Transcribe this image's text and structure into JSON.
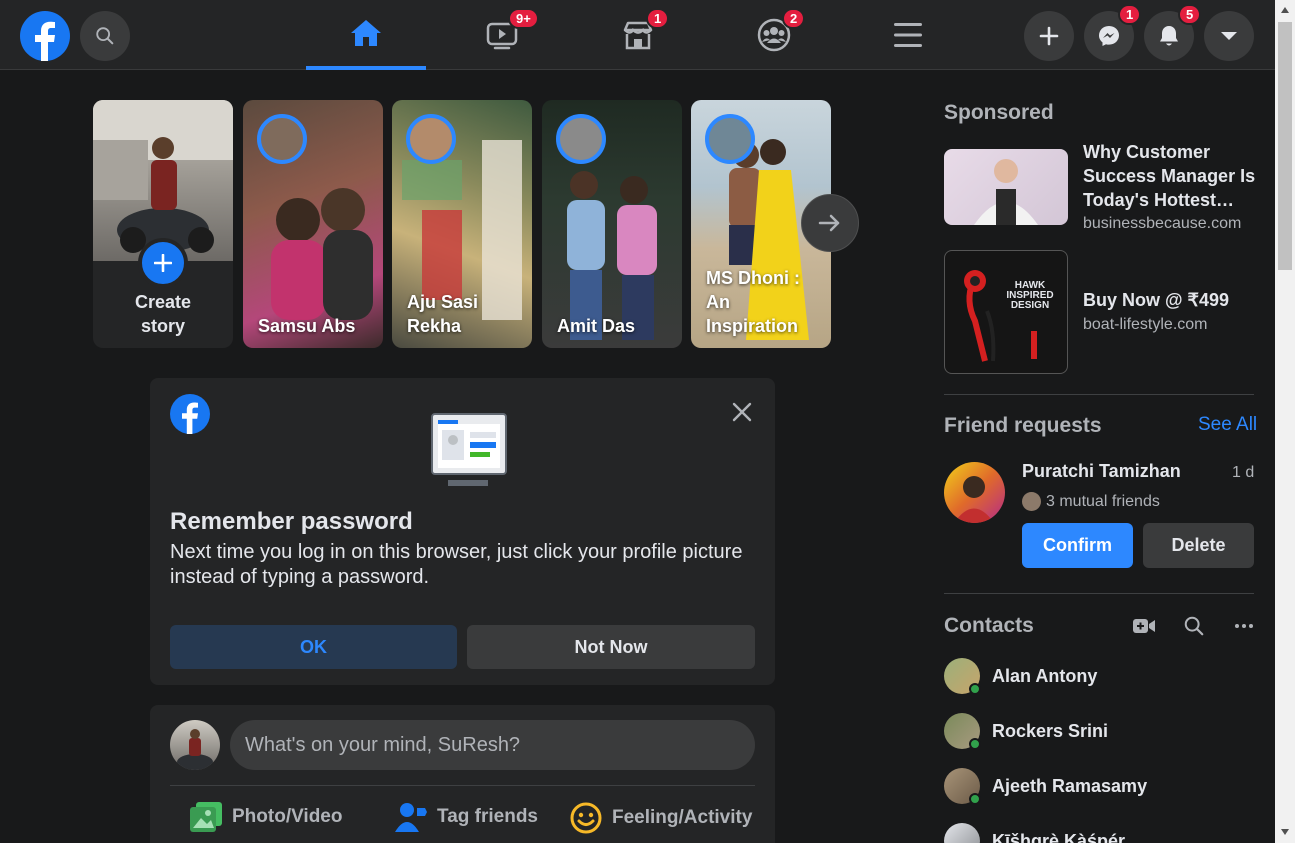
{
  "topbar": {
    "badges": {
      "watch": "9+",
      "marketplace": "1",
      "groups": "2",
      "messenger": "1",
      "notifications": "5"
    }
  },
  "stories": {
    "create_label": "Create story",
    "items": [
      {
        "name": "Samsu Abs"
      },
      {
        "name": "Aju Sasi Rekha"
      },
      {
        "name": "Amit Das"
      },
      {
        "name": "MS Dhoni : An Inspiration"
      }
    ]
  },
  "remember": {
    "title": "Remember password",
    "body": "Next time you log in on this browser, just click your profile picture instead of typing a password.",
    "ok_label": "OK",
    "not_now_label": "Not Now"
  },
  "composer": {
    "placeholder": "What's on your mind, SuResh?",
    "photo_label": "Photo/Video",
    "tag_label": "Tag friends",
    "feeling_label": "Feeling/Activity"
  },
  "sponsored": {
    "title": "Sponsored",
    "ads": [
      {
        "title": "Why Customer Success Manager Is Today's Hottest…",
        "domain": "businessbecause.com"
      },
      {
        "title": "Buy Now @ ₹499",
        "domain": "boat-lifestyle.com",
        "image_text": "HAWK INSPIRED DESIGN"
      }
    ]
  },
  "friend_requests": {
    "title": "Friend requests",
    "see_all": "See All",
    "request": {
      "name": "Puratchi Tamizhan",
      "time": "1 d",
      "mutual": "3 mutual friends"
    },
    "confirm_label": "Confirm",
    "delete_label": "Delete"
  },
  "contacts": {
    "title": "Contacts",
    "items": [
      {
        "name": "Alan Antony"
      },
      {
        "name": "Rockers Srini"
      },
      {
        "name": "Ajeeth Ramasamy"
      },
      {
        "name": "Kīšhgrè Kàśpér"
      }
    ]
  },
  "colors": {
    "accent": "#2d88ff",
    "badge": "#e41e3f",
    "card": "#242526",
    "bg": "#18191a"
  }
}
